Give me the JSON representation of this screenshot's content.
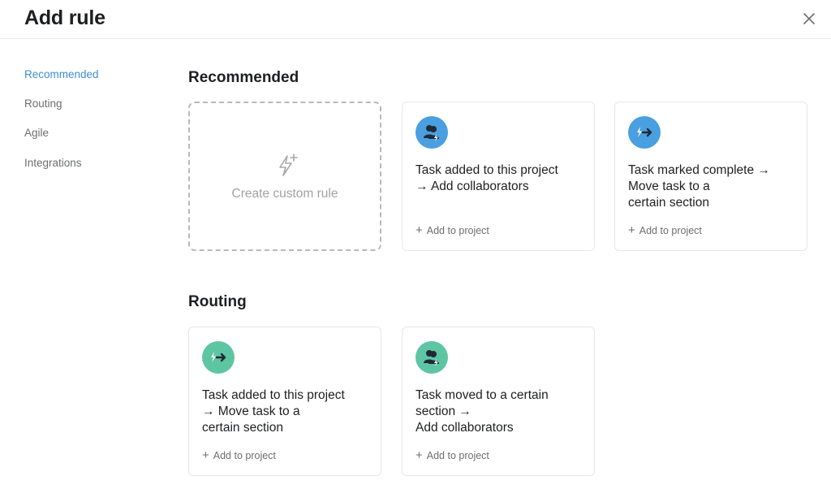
{
  "header": {
    "title": "Add rule",
    "close_icon": "close-icon"
  },
  "sidebar": {
    "items": [
      {
        "label": "Recommended",
        "active": true
      },
      {
        "label": "Routing",
        "active": false
      },
      {
        "label": "Agile",
        "active": false
      },
      {
        "label": "Integrations",
        "active": false
      }
    ]
  },
  "sections": [
    {
      "title": "Recommended",
      "custom_card": {
        "label": "Create custom rule",
        "icon": "sparkle-icon"
      },
      "cards": [
        {
          "icon": "collaborators-icon",
          "color": "#4a9fe0",
          "lines": [
            "Task added to this project",
            "→ Add collaborators"
          ],
          "action": "Add to project"
        },
        {
          "icon": "move-task-icon",
          "color": "#4a9fe0",
          "lines": [
            "Task marked complete →",
            "Move task to a",
            "certain section"
          ],
          "action": "Add to project"
        }
      ]
    },
    {
      "title": "Routing",
      "cards": [
        {
          "icon": "move-task-icon",
          "color": "#5ec5a3",
          "lines": [
            "Task added to this project",
            "→ Move task to a",
            "certain section"
          ],
          "action": "Add to project"
        },
        {
          "icon": "collaborators-icon",
          "color": "#5ec5a3",
          "lines": [
            "Task moved to a certain",
            "section →",
            "Add collaborators"
          ],
          "action": "Add to project"
        }
      ]
    }
  ],
  "colors": {
    "accent": "#3f8fcf",
    "blue_icon": "#4a9fe0",
    "green_icon": "#5ec5a3"
  }
}
